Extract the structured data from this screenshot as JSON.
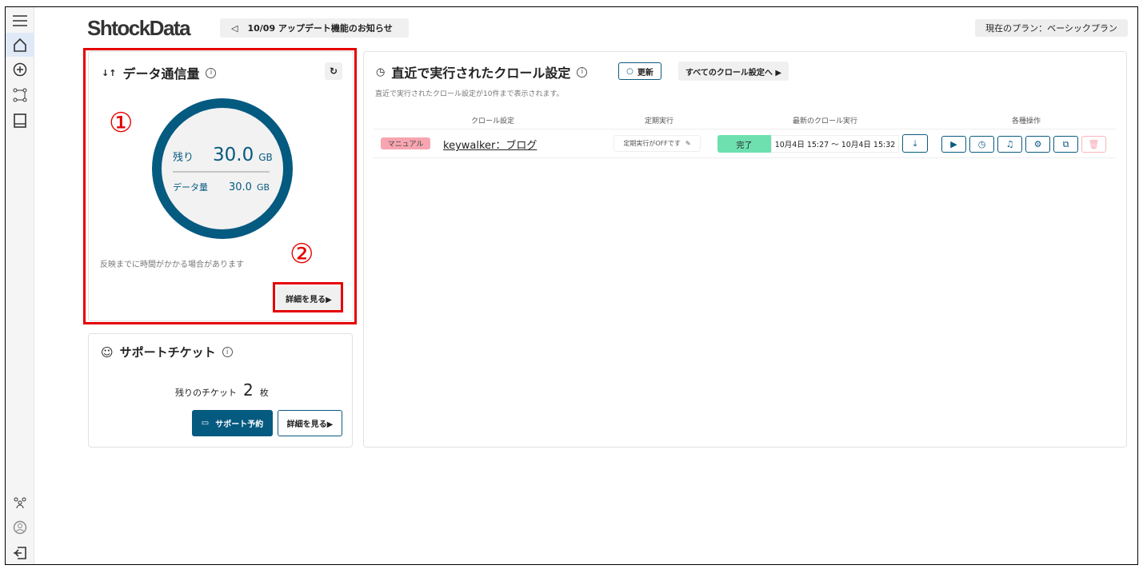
{
  "header": {
    "logo": "ShtockData",
    "notice": "10/09 アップデート機能のお知らせ",
    "plan": "現在のプラン：ベーシックプラン"
  },
  "sidebar": {
    "items": [
      "menu-icon",
      "home-icon",
      "add-icon",
      "flow-icon",
      "book-icon",
      "team-icon",
      "account-icon",
      "logout-icon"
    ]
  },
  "data_card": {
    "title": "データ通信量",
    "remaining_label": "残り",
    "remaining_value": "30.0",
    "remaining_unit": "GB",
    "amount_label": "データ量",
    "amount_value": "30.0",
    "amount_unit": "GB",
    "note": "反映までに時間がかかる場合があります",
    "details": "詳細を見る▶",
    "remaining_fraction": 1.0
  },
  "annotations": {
    "one": "①",
    "two": "②"
  },
  "support_card": {
    "title": "サポートチケット",
    "remaining_label": "残りのチケット",
    "count": "2",
    "unit": "枚",
    "reserve": "サポート予約",
    "details": "詳細を見る▶"
  },
  "recent": {
    "title": "直近で実行されたクロール設定",
    "refresh": "更新",
    "all": "すべてのクロール設定へ ▶",
    "subtitle": "直近で実行されたクロール設定が10件まで表示されます。",
    "columns": [
      "クロール設定",
      "定期実行",
      "最新のクロール実行",
      "各種操作"
    ],
    "rows": [
      {
        "tag": "マニュアル",
        "name": "keywalker：ブログ",
        "schedule": "定期実行がOFFです",
        "status": "完了",
        "time": "10月4日 15:27 ～ 10月4日 15:32"
      }
    ]
  },
  "colors": {
    "primary": "#055a80",
    "success": "#6ee0b0",
    "tag": "#f7a5b0",
    "annotation": "#e60000"
  }
}
